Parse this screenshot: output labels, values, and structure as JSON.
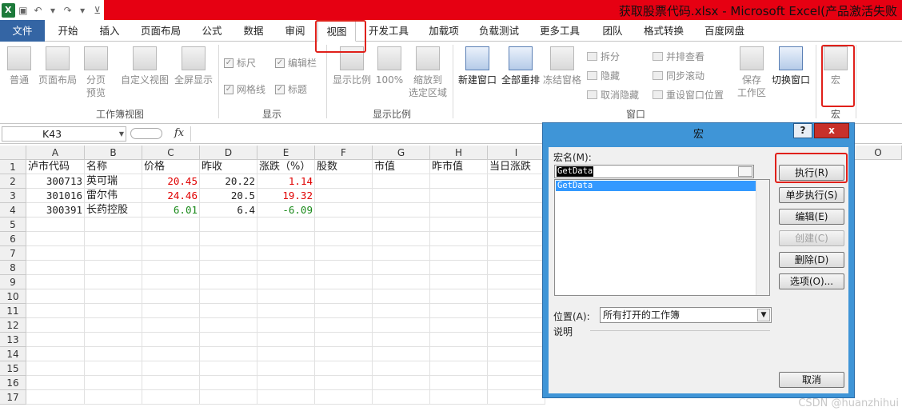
{
  "window": {
    "title": "获取股票代码.xlsx - Microsoft Excel(产品激活失败",
    "app_icon": "excel-icon"
  },
  "ribbon_tabs": [
    "文件",
    "开始",
    "插入",
    "页面布局",
    "公式",
    "数据",
    "审阅",
    "视图",
    "开发工具",
    "加载项",
    "负载测试",
    "更多工具",
    "团队",
    "格式转换",
    "百度网盘"
  ],
  "ribbon": {
    "workbook_views": {
      "label": "工作簿视图",
      "buttons": [
        "普通",
        "页面布局",
        "分页\n预览",
        "自定义视图",
        "全屏显示"
      ]
    },
    "show": {
      "label": "显示",
      "checkboxes": [
        "标尺",
        "编辑栏",
        "网格线",
        "标题"
      ]
    },
    "zoom": {
      "label": "显示比例",
      "buttons": [
        "显示比例",
        "100%",
        "缩放到\n选定区域"
      ]
    },
    "window": {
      "label": "窗口",
      "big_buttons": [
        "新建窗口",
        "全部重排",
        "冻结窗格"
      ],
      "small_buttons": [
        "拆分",
        "隐藏",
        "取消隐藏",
        "并排查看",
        "同步滚动",
        "重设窗口位置"
      ],
      "save_workspace": "保存\n工作区",
      "switch_windows": "切换窗口"
    },
    "macros": {
      "label": "宏",
      "button": "宏"
    }
  },
  "formula_bar": {
    "name_box": "K43",
    "fx": "fx",
    "value": ""
  },
  "sheet": {
    "columns": [
      "A",
      "B",
      "C",
      "D",
      "E",
      "F",
      "G",
      "H",
      "I",
      "O"
    ],
    "rows": [
      "1",
      "2",
      "3",
      "4",
      "5",
      "6",
      "7",
      "8",
      "9",
      "10",
      "11",
      "12",
      "13",
      "14",
      "15",
      "16",
      "17"
    ],
    "header_row": [
      "泸市代码",
      "名称",
      "价格",
      "昨收",
      "涨跌（%）",
      "股数",
      "市值",
      "昨市值",
      "当日涨跌"
    ],
    "data": [
      {
        "code": "300713",
        "name": "英可瑞",
        "price": "20.45",
        "prev": "20.22",
        "change": "1.14",
        "color": "#e00000"
      },
      {
        "code": "301016",
        "name": "雷尔伟",
        "price": "24.46",
        "prev": "20.5",
        "change": "19.32",
        "color": "#e00000"
      },
      {
        "code": "300391",
        "name": "长药控股",
        "price": "6.01",
        "prev": "6.4",
        "change": "-6.09",
        "color": "#1a8a1a"
      }
    ]
  },
  "dialog": {
    "title": "宏",
    "help": "?",
    "close": "x",
    "macro_name_label": "宏名(M):",
    "macro_name_value": "GetData",
    "macro_list": [
      "GetData"
    ],
    "buttons": {
      "run": "执行(R)",
      "step": "单步执行(S)",
      "edit": "编辑(E)",
      "create": "创建(C)",
      "delete": "删除(D)",
      "options": "选项(O)...",
      "cancel": "取消"
    },
    "location_label": "位置(A):",
    "location_value": "所有打开的工作簿",
    "description_label": "说明"
  },
  "watermark": "CSDN @huanzhihui"
}
